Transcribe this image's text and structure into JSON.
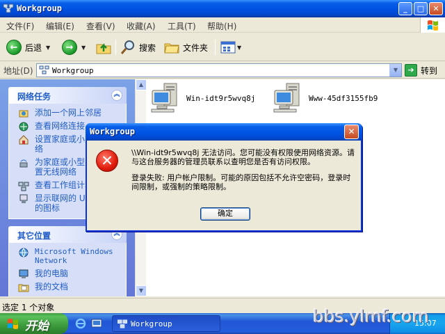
{
  "window": {
    "title": "Workgroup",
    "min_icon": "minimize-icon",
    "max_icon": "maximize-icon",
    "close_icon": "close-icon"
  },
  "menu": [
    "文件(F)",
    "编辑(E)",
    "查看(V)",
    "收藏(A)",
    "工具(T)",
    "帮助(H)"
  ],
  "toolbar": {
    "back": "后退",
    "search": "搜索",
    "folders": "文件夹"
  },
  "address": {
    "label": "地址(D)",
    "value": "Workgroup",
    "go": "转到"
  },
  "network_tasks": {
    "title": "网络任务",
    "items": [
      "添加一个网上邻居",
      "查看网络连接",
      "设置家庭或小型办公网络",
      "为家庭或小型办公室设置无线网络",
      "查看工作组计算机",
      "显示联网的 UPnP 设备的图标"
    ]
  },
  "other_places": {
    "title": "其它位置",
    "items": [
      "Microsoft Windows Network",
      "我的电脑",
      "我的文档"
    ]
  },
  "computers": [
    "Win-idt9r5wvq8j",
    "Www-45df3155fb9"
  ],
  "status": "选定 1 个对象",
  "dialog": {
    "title": "Workgroup",
    "line1": "\\\\Win-idt9r5wvq8j 无法访问。您可能没有权限使用网络资源。请与这台服务器的管理员联系以查明您是否有访问权限。",
    "line2": "登录失败: 用户帐户限制。可能的原因包括不允许空密码，登录时间限制，或强制的策略限制。",
    "ok": "确定"
  },
  "taskbar": {
    "start": "开始",
    "task": "Workgroup",
    "clock": "15:07"
  },
  "watermark": "bbs.ylmf.com",
  "colors": {
    "title_blue": "#0054E3",
    "task_link": "#215DC6",
    "taskbar_blue": "#245EDC",
    "start_green": "#3C9A3C",
    "error_red": "#E01B0B"
  }
}
